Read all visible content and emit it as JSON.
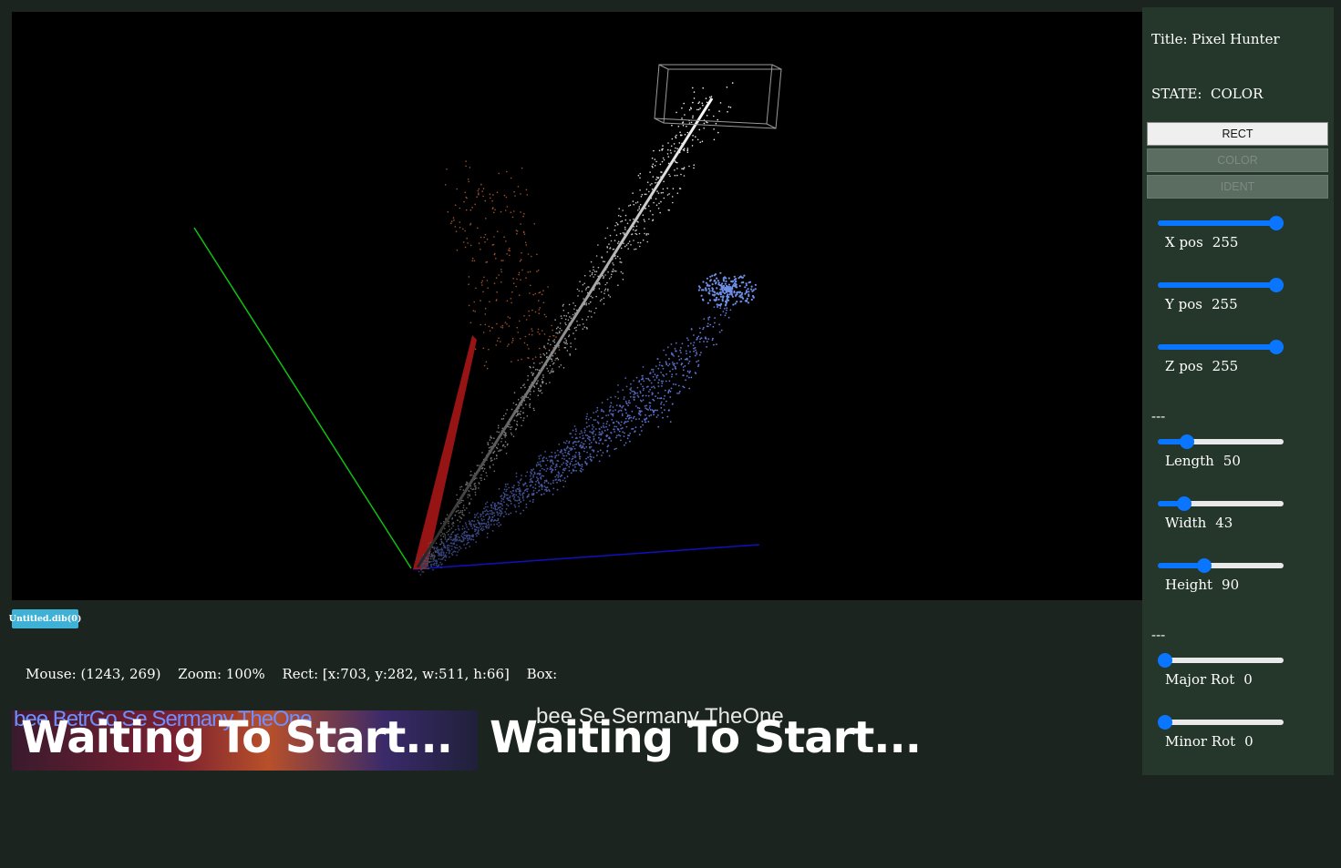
{
  "panel": {
    "title_label": "Title:",
    "title_value": "Pixel Hunter",
    "state_label": "STATE:",
    "state_value": "COLOR",
    "buttons": [
      {
        "label": "RECT",
        "state": "active"
      },
      {
        "label": "COLOR",
        "state": "disabled"
      },
      {
        "label": "IDENT",
        "state": "disabled"
      }
    ],
    "position_sliders": [
      {
        "label": "X pos",
        "value": "255",
        "fraction": 1.0
      },
      {
        "label": "Y pos",
        "value": "255",
        "fraction": 1.0
      },
      {
        "label": "Z pos",
        "value": "255",
        "fraction": 1.0
      }
    ],
    "separator1": "---",
    "size_sliders": [
      {
        "label": "Length",
        "value": "50",
        "fraction": 0.196
      },
      {
        "label": "Width",
        "value": "43",
        "fraction": 0.169
      },
      {
        "label": "Height",
        "value": "90",
        "fraction": 0.353
      }
    ],
    "separator2": "---",
    "rotation_sliders": [
      {
        "label": "Major Rot",
        "value": "0",
        "fraction": 0.0
      },
      {
        "label": "Minor Rot",
        "value": "0",
        "fraction": 0.0
      }
    ]
  },
  "tab_badge": "Untitled.dib(0)",
  "status": {
    "mouse": "Mouse: (1243, 269)",
    "zoom": "Zoom: 100%",
    "rect": "Rect:  [x:703, y:282, w:511, h:66]",
    "box": "Box:"
  },
  "preview": {
    "overlay_text": "Waiting To Start...",
    "ghost_left": "bee BetrGo Se Sermany TheOne",
    "ghost_right": "bee          Se Sermany TheOne"
  },
  "colors": {
    "background": "#1b241e",
    "panel": "#24372a",
    "accent": "#0a75ff",
    "badge": "#3fb1d6",
    "axis_x": "#1010c0",
    "axis_y": "#10c010",
    "axis_z": "#d01010"
  }
}
